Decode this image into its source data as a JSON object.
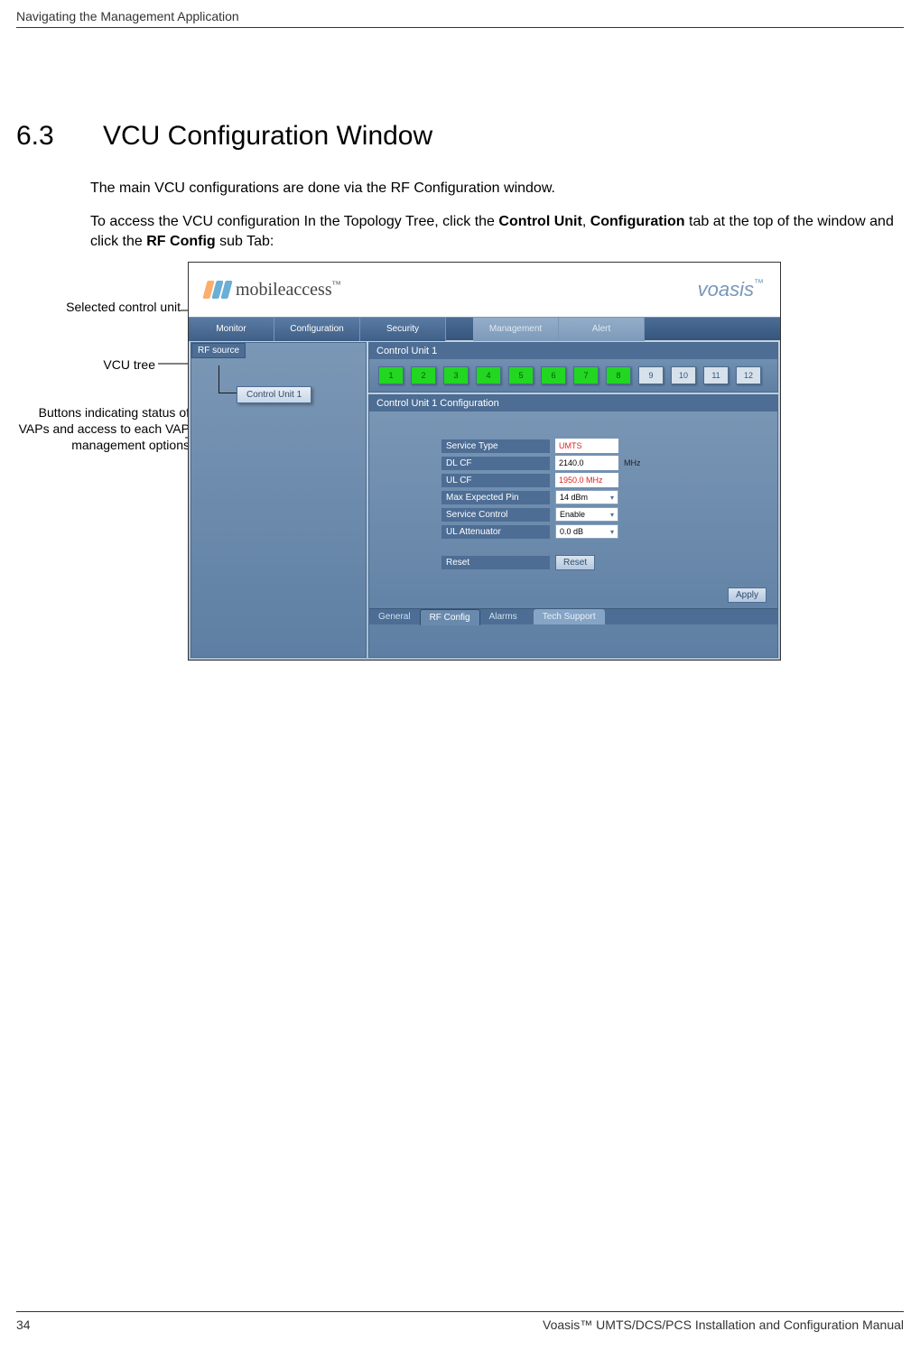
{
  "header": {
    "chapter_title": "Navigating the Management Application"
  },
  "section": {
    "number": "6.3",
    "title": "VCU Configuration Window"
  },
  "paragraphs": {
    "p1": "The main VCU configurations are done via the RF Configuration window.",
    "p2a": "To access the VCU configuration In the Topology Tree, click the ",
    "p2b": "Control Unit",
    "p2c": ", ",
    "p2d": "Configuration",
    "p2e": " tab at the top of the window and click the ",
    "p2f": "RF Config",
    "p2g": " sub Tab:"
  },
  "callouts": {
    "c1": "Selected control unit",
    "c2": "VCU tree",
    "c3": "Buttons indicating status of VAPs and access to each VAP management options"
  },
  "app": {
    "logo_text": "mobileaccess",
    "suffix_tm": "™",
    "brand_right": "voasis",
    "nav": {
      "monitor": "Monitor",
      "configuration": "Configuration",
      "security": "Security",
      "management": "Management",
      "alert": "Alert"
    },
    "left_pane": {
      "rf_source": "RF source",
      "control_unit_node": "Control Unit 1"
    },
    "top_panel": {
      "header": "Control Unit 1",
      "buttons": [
        "1",
        "2",
        "3",
        "4",
        "5",
        "6",
        "7",
        "8",
        "9",
        "10",
        "11",
        "12"
      ],
      "green_indices": [
        0,
        1,
        2,
        3,
        4,
        5,
        6,
        7
      ]
    },
    "config_panel": {
      "header": "Control Unit 1 Configuration",
      "rows": {
        "service_type": {
          "label": "Service Type",
          "value": "UMTS"
        },
        "dl_cf": {
          "label": "DL CF",
          "value": "2140.0",
          "suffix": "MHz"
        },
        "ul_cf": {
          "label": "UL CF",
          "value": "1950.0 MHz"
        },
        "max_pin": {
          "label": "Max Expected Pin",
          "value": "14 dBm"
        },
        "service_control": {
          "label": "Service Control",
          "value": "Enable"
        },
        "ul_attenuator": {
          "label": "UL Attenuator",
          "value": "0.0 dB"
        },
        "reset": {
          "label": "Reset",
          "button": "Reset"
        }
      },
      "apply": "Apply",
      "sub_tabs": {
        "general": "General",
        "rf_config": "RF Config",
        "alarms": "Alarms",
        "tech_support": "Tech Support"
      }
    }
  },
  "footer": {
    "page_number": "34",
    "manual_title": "Voasis™ UMTS/DCS/PCS Installation and Configuration Manual"
  }
}
